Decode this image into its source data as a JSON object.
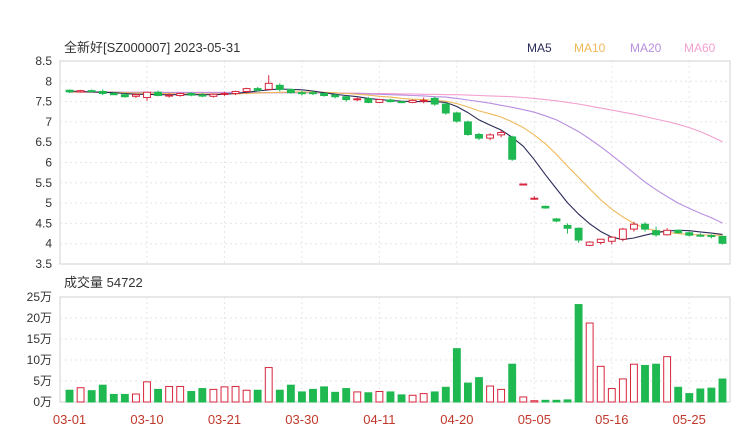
{
  "chart_data": [
    {
      "type": "candlestick",
      "title": "全新好[SZ000007] 2023-05-31",
      "legend": [
        {
          "label": "MA5",
          "color": "#2b2b5a"
        },
        {
          "label": "MA10",
          "color": "#f0b85a"
        },
        {
          "label": "MA20",
          "color": "#b98fe0"
        },
        {
          "label": "MA60",
          "color": "#f2a0d0"
        }
      ],
      "y_ticks": [
        "8.5",
        "8",
        "7.5",
        "7",
        "6.5",
        "6",
        "5.5",
        "5",
        "4.5",
        "4",
        "3.5"
      ],
      "ylim": [
        3.5,
        8.5
      ],
      "x_tick_labels": [
        "03-01",
        "03-10",
        "03-21",
        "03-30",
        "04-11",
        "04-20",
        "05-05",
        "05-16",
        "05-25"
      ],
      "x_tick_indices": [
        0,
        7,
        14,
        21,
        28,
        35,
        42,
        49,
        56
      ],
      "colors": {
        "up": "#d7263d",
        "down": "#1fb851",
        "ma5": "#2b2b5a",
        "ma10": "#f0b85a",
        "ma20": "#b98fe0",
        "ma60": "#f2a0d0"
      },
      "candles": [
        [
          7.78,
          7.8,
          7.71,
          7.74
        ],
        [
          7.74,
          7.79,
          7.72,
          7.77
        ],
        [
          7.77,
          7.8,
          7.73,
          7.75
        ],
        [
          7.75,
          7.8,
          7.66,
          7.7
        ],
        [
          7.7,
          7.74,
          7.66,
          7.67
        ],
        [
          7.67,
          7.72,
          7.6,
          7.62
        ],
        [
          7.63,
          7.7,
          7.59,
          7.67
        ],
        [
          7.6,
          7.74,
          7.52,
          7.73
        ],
        [
          7.73,
          7.77,
          7.63,
          7.65
        ],
        [
          7.64,
          7.7,
          7.6,
          7.66
        ],
        [
          7.65,
          7.72,
          7.62,
          7.7
        ],
        [
          7.7,
          7.73,
          7.63,
          7.66
        ],
        [
          7.66,
          7.71,
          7.61,
          7.64
        ],
        [
          7.63,
          7.69,
          7.6,
          7.68
        ],
        [
          7.68,
          7.74,
          7.64,
          7.7
        ],
        [
          7.7,
          7.77,
          7.66,
          7.75
        ],
        [
          7.75,
          7.84,
          7.7,
          7.82
        ],
        [
          7.82,
          7.86,
          7.75,
          7.78
        ],
        [
          7.8,
          8.15,
          7.78,
          7.95
        ],
        [
          7.9,
          7.95,
          7.75,
          7.8
        ],
        [
          7.8,
          7.82,
          7.7,
          7.72
        ],
        [
          7.72,
          7.76,
          7.65,
          7.71
        ],
        [
          7.72,
          7.76,
          7.66,
          7.7
        ],
        [
          7.7,
          7.72,
          7.62,
          7.65
        ],
        [
          7.66,
          7.7,
          7.58,
          7.62
        ],
        [
          7.62,
          7.64,
          7.5,
          7.55
        ],
        [
          7.55,
          7.6,
          7.51,
          7.57
        ],
        [
          7.57,
          7.62,
          7.46,
          7.48
        ],
        [
          7.48,
          7.57,
          7.46,
          7.55
        ],
        [
          7.54,
          7.57,
          7.48,
          7.5
        ],
        [
          7.5,
          7.52,
          7.46,
          7.48
        ],
        [
          7.48,
          7.55,
          7.46,
          7.53
        ],
        [
          7.51,
          7.6,
          7.46,
          7.53
        ],
        [
          7.58,
          7.62,
          7.4,
          7.44
        ],
        [
          7.44,
          7.48,
          7.18,
          7.22
        ],
        [
          7.22,
          7.25,
          6.98,
          7.02
        ],
        [
          7.0,
          7.03,
          6.66,
          6.69
        ],
        [
          6.69,
          6.73,
          6.55,
          6.6
        ],
        [
          6.6,
          6.72,
          6.55,
          6.68
        ],
        [
          6.68,
          6.8,
          6.62,
          6.74
        ],
        [
          6.63,
          6.66,
          6.04,
          6.08
        ],
        [
          5.47,
          5.47,
          5.47,
          5.47
        ],
        [
          5.12,
          5.17,
          5.08,
          5.12
        ],
        [
          4.92,
          4.94,
          4.86,
          4.88
        ],
        [
          4.61,
          4.63,
          4.53,
          4.56
        ],
        [
          4.45,
          4.5,
          4.25,
          4.38
        ],
        [
          4.38,
          4.4,
          4.02,
          4.09
        ],
        [
          3.96,
          4.06,
          3.94,
          4.04
        ],
        [
          4.03,
          4.12,
          3.98,
          4.11
        ],
        [
          4.06,
          4.18,
          3.98,
          4.16
        ],
        [
          4.11,
          4.39,
          4.06,
          4.36
        ],
        [
          4.36,
          4.54,
          4.3,
          4.48
        ],
        [
          4.48,
          4.53,
          4.3,
          4.36
        ],
        [
          4.32,
          4.42,
          4.17,
          4.22
        ],
        [
          4.22,
          4.38,
          4.2,
          4.33
        ],
        [
          4.33,
          4.35,
          4.25,
          4.27
        ],
        [
          4.27,
          4.3,
          4.18,
          4.21
        ],
        [
          4.21,
          4.26,
          4.17,
          4.2
        ],
        [
          4.2,
          4.23,
          4.13,
          4.18
        ],
        [
          4.18,
          4.2,
          3.98,
          4.01
        ]
      ],
      "ma5": [
        7.76,
        7.75,
        7.74,
        7.73,
        7.72,
        7.7,
        7.68,
        7.68,
        7.67,
        7.67,
        7.67,
        7.67,
        7.67,
        7.67,
        7.68,
        7.7,
        7.73,
        7.76,
        7.79,
        7.81,
        7.8,
        7.79,
        7.76,
        7.72,
        7.68,
        7.65,
        7.62,
        7.58,
        7.55,
        7.53,
        7.51,
        7.5,
        7.5,
        7.5,
        7.48,
        7.38,
        7.23,
        7.05,
        6.92,
        6.8,
        6.62,
        6.4,
        6.07,
        5.7,
        5.35,
        5.01,
        4.73,
        4.49,
        4.3,
        4.16,
        4.1,
        4.14,
        4.21,
        4.27,
        4.31,
        4.33,
        4.32,
        4.29,
        4.26,
        4.23
      ],
      "ma10": [
        7.74,
        7.74,
        7.74,
        7.73,
        7.73,
        7.72,
        7.71,
        7.71,
        7.7,
        7.7,
        7.69,
        7.69,
        7.69,
        7.69,
        7.69,
        7.69,
        7.7,
        7.71,
        7.72,
        7.73,
        7.74,
        7.74,
        7.74,
        7.73,
        7.72,
        7.7,
        7.68,
        7.66,
        7.63,
        7.61,
        7.58,
        7.56,
        7.55,
        7.53,
        7.51,
        7.45,
        7.37,
        7.27,
        7.2,
        7.12,
        7.0,
        6.86,
        6.68,
        6.46,
        6.2,
        5.91,
        5.63,
        5.35,
        5.08,
        4.85,
        4.66,
        4.5,
        4.38,
        4.32,
        4.28,
        4.25,
        4.23,
        4.22,
        4.21,
        4.21
      ],
      "ma20": [
        7.74,
        7.74,
        7.74,
        7.74,
        7.74,
        7.73,
        7.73,
        7.73,
        7.73,
        7.72,
        7.72,
        7.72,
        7.72,
        7.72,
        7.72,
        7.72,
        7.72,
        7.72,
        7.72,
        7.72,
        7.72,
        7.72,
        7.72,
        7.71,
        7.71,
        7.7,
        7.7,
        7.69,
        7.68,
        7.67,
        7.66,
        7.65,
        7.64,
        7.62,
        7.61,
        7.58,
        7.54,
        7.5,
        7.46,
        7.41,
        7.36,
        7.3,
        7.24,
        7.15,
        7.05,
        6.91,
        6.76,
        6.58,
        6.39,
        6.18,
        5.96,
        5.74,
        5.52,
        5.33,
        5.16,
        5.0,
        4.87,
        4.75,
        4.64,
        4.51
      ],
      "ma60": [
        7.73,
        7.73,
        7.73,
        7.73,
        7.73,
        7.73,
        7.73,
        7.73,
        7.73,
        7.73,
        7.73,
        7.73,
        7.73,
        7.73,
        7.73,
        7.73,
        7.72,
        7.72,
        7.72,
        7.72,
        7.72,
        7.72,
        7.72,
        7.72,
        7.71,
        7.71,
        7.71,
        7.7,
        7.7,
        7.7,
        7.69,
        7.69,
        7.68,
        7.68,
        7.67,
        7.67,
        7.66,
        7.65,
        7.64,
        7.63,
        7.62,
        7.6,
        7.58,
        7.55,
        7.52,
        7.48,
        7.44,
        7.39,
        7.34,
        7.29,
        7.24,
        7.19,
        7.13,
        7.07,
        7.01,
        6.94,
        6.86,
        6.76,
        6.64,
        6.51
      ]
    },
    {
      "type": "bar",
      "title": "成交量 54722",
      "y_ticks": [
        "25万",
        "20万",
        "15万",
        "10万",
        "5万",
        "0万"
      ],
      "ylim": [
        0,
        250000
      ],
      "x_tick_labels": [
        "03-01",
        "03-10",
        "03-21",
        "03-30",
        "04-11",
        "04-20",
        "05-05",
        "05-16",
        "05-25"
      ],
      "values": [
        28000,
        34000,
        27000,
        40000,
        18000,
        18000,
        19000,
        48000,
        30000,
        37000,
        37000,
        25000,
        32000,
        30000,
        36000,
        37000,
        28000,
        28000,
        82000,
        28000,
        40000,
        24000,
        30000,
        36000,
        23000,
        32000,
        24000,
        22000,
        25000,
        24000,
        17000,
        16000,
        20000,
        24000,
        35000,
        127000,
        45000,
        58000,
        38000,
        30000,
        90000,
        12000,
        3000,
        4000,
        4000,
        5000,
        232000,
        188000,
        85000,
        32000,
        55000,
        90000,
        87000,
        90000,
        108000,
        35000,
        20000,
        31000,
        33000,
        54722
      ],
      "colors_up_down": "follow candles"
    }
  ]
}
